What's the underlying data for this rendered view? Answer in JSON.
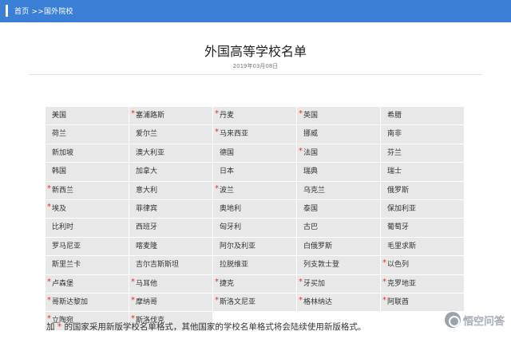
{
  "breadcrumb": {
    "home": "首页",
    "separator": " >>",
    "current": "国外院校"
  },
  "header": {
    "title": "外国高等学校名单",
    "date": "2019年03月08日"
  },
  "colors": {
    "accent": "#3b7fd6",
    "marker": "#e0302b",
    "cell": "#e8e8e8"
  },
  "marker_symbol": "*",
  "countries": [
    {
      "name": "美国",
      "marked": false
    },
    {
      "name": "塞浦路斯",
      "marked": true
    },
    {
      "name": "丹麦",
      "marked": true
    },
    {
      "name": "英国",
      "marked": true
    },
    {
      "name": "希腊",
      "marked": false
    },
    {
      "name": "荷兰",
      "marked": false
    },
    {
      "name": "爱尔兰",
      "marked": false
    },
    {
      "name": "马来西亚",
      "marked": true
    },
    {
      "name": "挪威",
      "marked": false
    },
    {
      "name": "南非",
      "marked": false
    },
    {
      "name": "新加坡",
      "marked": false
    },
    {
      "name": "澳大利亚",
      "marked": false
    },
    {
      "name": "德国",
      "marked": false
    },
    {
      "name": "法国",
      "marked": true
    },
    {
      "name": "芬兰",
      "marked": false
    },
    {
      "name": "韩国",
      "marked": false
    },
    {
      "name": "加拿大",
      "marked": false
    },
    {
      "name": "日本",
      "marked": false
    },
    {
      "name": "瑞典",
      "marked": false
    },
    {
      "name": "瑞士",
      "marked": false
    },
    {
      "name": "新西兰",
      "marked": true
    },
    {
      "name": "意大利",
      "marked": false
    },
    {
      "name": "波兰",
      "marked": true
    },
    {
      "name": "乌克兰",
      "marked": false
    },
    {
      "name": "俄罗斯",
      "marked": false
    },
    {
      "name": "埃及",
      "marked": true
    },
    {
      "name": "菲律宾",
      "marked": false
    },
    {
      "name": "奥地利",
      "marked": false
    },
    {
      "name": "泰国",
      "marked": false
    },
    {
      "name": "保加利亚",
      "marked": false
    },
    {
      "name": "比利时",
      "marked": false
    },
    {
      "name": "西班牙",
      "marked": false
    },
    {
      "name": "匈牙利",
      "marked": false
    },
    {
      "name": "古巴",
      "marked": false
    },
    {
      "name": "葡萄牙",
      "marked": false
    },
    {
      "name": "罗马尼亚",
      "marked": false
    },
    {
      "name": "喀麦隆",
      "marked": false
    },
    {
      "name": "阿尔及利亚",
      "marked": false
    },
    {
      "name": "白俄罗斯",
      "marked": false
    },
    {
      "name": "毛里求斯",
      "marked": false
    },
    {
      "name": "斯里兰卡",
      "marked": false
    },
    {
      "name": "吉尔吉斯斯坦",
      "marked": false
    },
    {
      "name": "拉脱维亚",
      "marked": false
    },
    {
      "name": "列支敦士登",
      "marked": false
    },
    {
      "name": "以色列",
      "marked": true
    },
    {
      "name": "卢森堡",
      "marked": true
    },
    {
      "name": "马耳他",
      "marked": true
    },
    {
      "name": "捷克",
      "marked": true
    },
    {
      "name": "牙买加",
      "marked": true
    },
    {
      "name": "克罗地亚",
      "marked": true
    },
    {
      "name": "哥斯达黎加",
      "marked": true
    },
    {
      "name": "摩纳哥",
      "marked": true
    },
    {
      "name": "斯洛文尼亚",
      "marked": true
    },
    {
      "name": "格林纳达",
      "marked": true
    },
    {
      "name": "阿联酋",
      "marked": true
    },
    {
      "name": "立陶宛",
      "marked": true
    },
    {
      "name": "斯洛伐克",
      "marked": true
    }
  ],
  "footnote": {
    "prefix": "加",
    "star": "*",
    "text": "的国家采用新版学校名单格式，其他国家的学校名单格式将会陆续使用新版格式。"
  },
  "watermark": {
    "text": "悟空问答",
    "icon": "wukong-logo-icon"
  }
}
